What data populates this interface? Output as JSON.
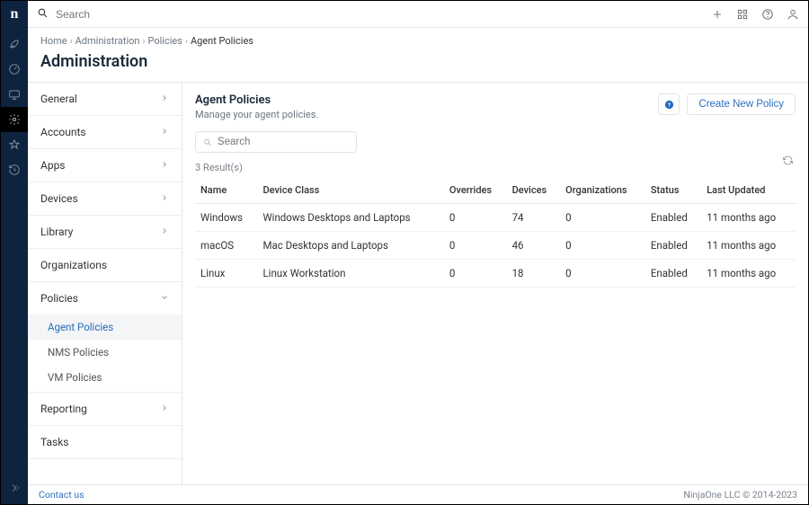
{
  "topbar": {
    "search_placeholder": "Search"
  },
  "breadcrumbs": {
    "items": [
      "Home",
      "Administration",
      "Policies",
      "Agent Policies"
    ]
  },
  "page_title": "Administration",
  "sidenav": {
    "sections": [
      {
        "label": "General",
        "expandable": true
      },
      {
        "label": "Accounts",
        "expandable": true
      },
      {
        "label": "Apps",
        "expandable": true
      },
      {
        "label": "Devices",
        "expandable": true
      },
      {
        "label": "Library",
        "expandable": true
      },
      {
        "label": "Organizations",
        "expandable": false
      },
      {
        "label": "Policies",
        "expandable": true,
        "expanded": true,
        "subs": [
          {
            "label": "Agent Policies",
            "active": true
          },
          {
            "label": "NMS Policies"
          },
          {
            "label": "VM Policies"
          }
        ]
      },
      {
        "label": "Reporting",
        "expandable": true
      },
      {
        "label": "Tasks",
        "expandable": false
      }
    ]
  },
  "panel": {
    "heading": "Agent Policies",
    "subheading": "Manage your agent policies.",
    "create_button": "Create New Policy",
    "search_placeholder": "Search",
    "result_count": "3 Result(s)",
    "columns": [
      "Name",
      "Device Class",
      "Overrides",
      "Devices",
      "Organizations",
      "Status",
      "Last Updated"
    ],
    "rows": [
      {
        "name": "Windows",
        "class": "Windows Desktops and Laptops",
        "overrides": "0",
        "devices": "74",
        "orgs": "0",
        "status": "Enabled",
        "updated": "11 months ago"
      },
      {
        "name": "macOS",
        "class": "Mac Desktops and Laptops",
        "overrides": "0",
        "devices": "46",
        "orgs": "0",
        "status": "Enabled",
        "updated": "11 months ago"
      },
      {
        "name": "Linux",
        "class": "Linux Workstation",
        "overrides": "0",
        "devices": "18",
        "orgs": "0",
        "status": "Enabled",
        "updated": "11 months ago"
      }
    ]
  },
  "footer": {
    "contact": "Contact us",
    "copyright": "NinjaOne LLC © 2014-2023"
  }
}
